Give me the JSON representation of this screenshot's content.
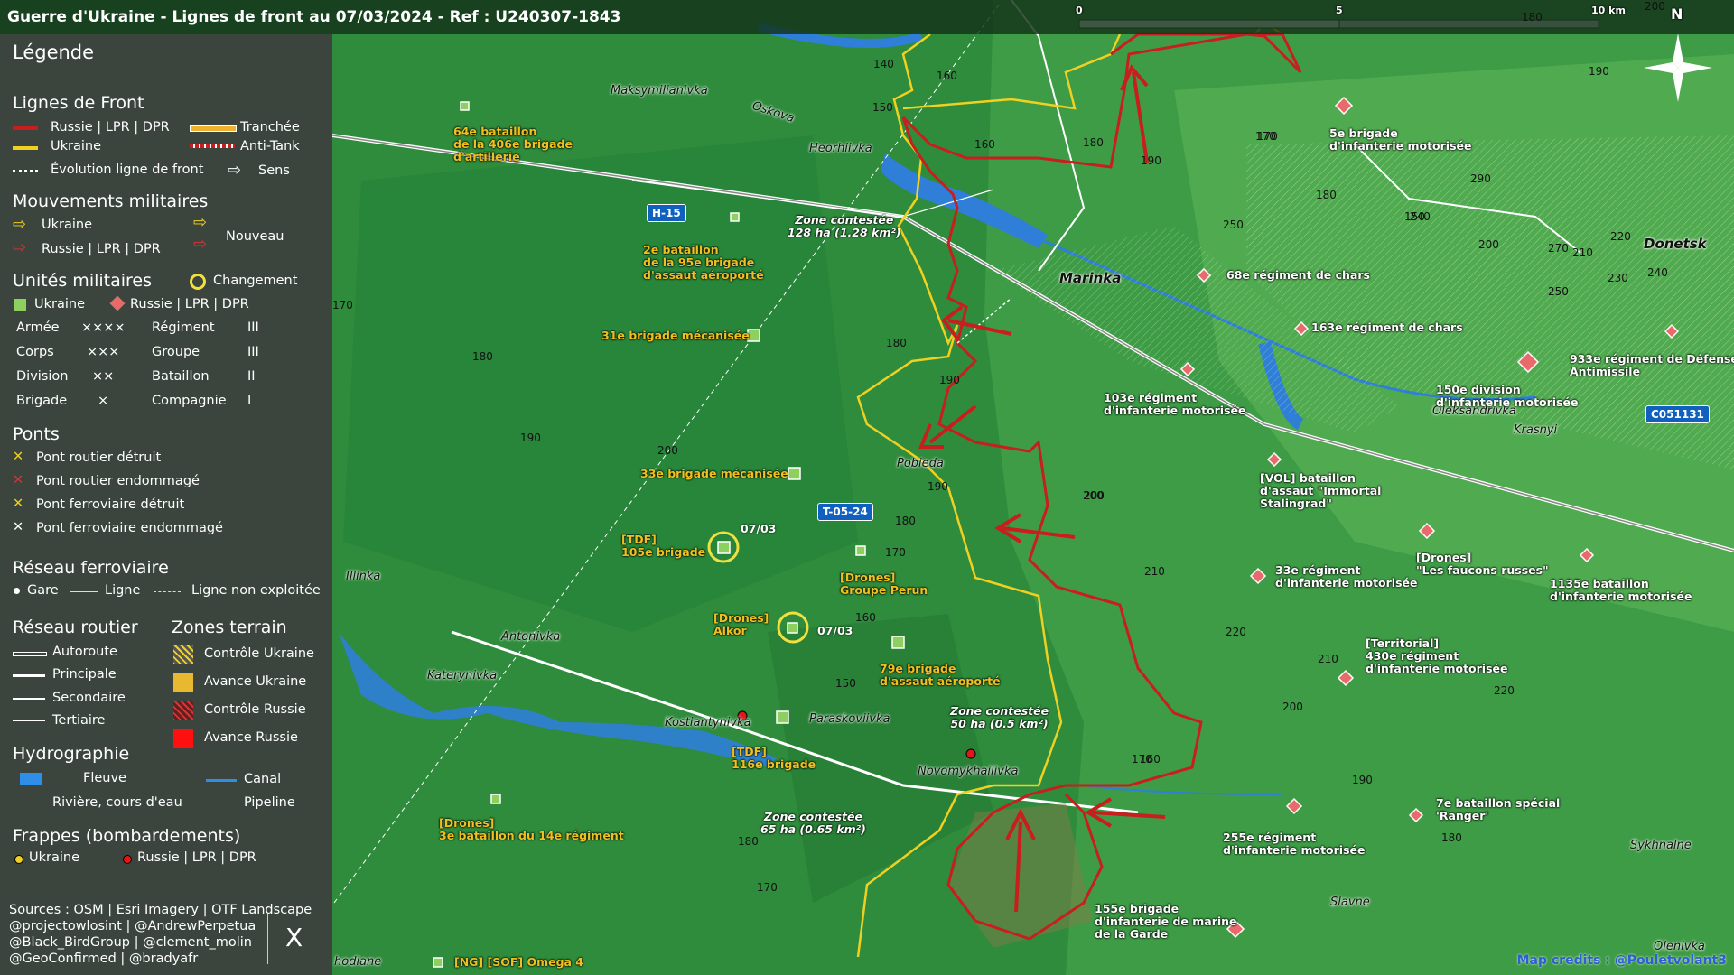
{
  "title": "Guerre d'Ukraine - Lignes de front au 07/03/2024 - Ref : U240307-1843",
  "scale": {
    "t0": "0",
    "t5": "5",
    "t10": "10 km"
  },
  "north": "N",
  "credits": "Map credits : @Pouletvolant3",
  "legend": {
    "title": "Légende",
    "front": {
      "title": "Lignes de Front",
      "russia": "Russie | LPR | DPR",
      "ukraine": "Ukraine",
      "trench": "Tranchée",
      "antitank": "Anti-Tank",
      "evolution": "Évolution ligne de front",
      "direction": "Sens"
    },
    "moves": {
      "title": "Mouvements militaires",
      "ukraine": "Ukraine",
      "russia": "Russie | LPR | DPR",
      "new": "Nouveau"
    },
    "units": {
      "title": "Unités militaires",
      "change": "Changement",
      "ukraine": "Ukraine",
      "russia": "Russie | LPR | DPR",
      "rows": [
        {
          "a": "Armée",
          "as": "××××",
          "b": "Régiment",
          "bs": "III"
        },
        {
          "a": "Corps",
          "as": "×××",
          "b": "Groupe",
          "bs": "III"
        },
        {
          "a": "Division",
          "as": "××",
          "b": "Bataillon",
          "bs": "II"
        },
        {
          "a": "Brigade",
          "as": "×",
          "b": "Compagnie",
          "bs": "I"
        }
      ]
    },
    "bridges": {
      "title": "Ponts",
      "items": [
        "Pont routier détruit",
        "Pont routier endommagé",
        "Pont ferroviaire détruit",
        "Pont ferroviaire endommagé"
      ]
    },
    "rail": {
      "title": "Réseau ferroviaire",
      "station": "Gare",
      "line": "Ligne",
      "unused": "Ligne non exploitée"
    },
    "roads": {
      "title": "Réseau routier",
      "items": [
        "Autoroute",
        "Principale",
        "Secondaire",
        "Tertiaire"
      ]
    },
    "zones": {
      "title": "Zones terrain",
      "items": [
        "Contrôle Ukraine",
        "Avance Ukraine",
        "Contrôle Russie",
        "Avance Russie"
      ]
    },
    "hydro": {
      "title": "Hydrographie",
      "river": "Fleuve",
      "canal": "Canal",
      "stream": "Rivière, cours d'eau",
      "pipeline": "Pipeline"
    },
    "strikes": {
      "title": "Frappes (bombardements)",
      "ukraine": "Ukraine",
      "russia": "Russie | LPR | DPR"
    },
    "sources": [
      "Sources : OSM | Esri Imagery | OTF Landscape",
      "@projectowlosint | @AndrewPerpetua",
      "@Black_BirdGroup | @clement_molin",
      "@GeoConfirmed | @bradyafr"
    ],
    "x_logo": "X"
  },
  "colors": {
    "russia": "#c81e1e",
    "ukraine": "#f0d020",
    "legend_bg": "#3c403e",
    "map_green": "#2a8a3a",
    "water": "#2f7fd8"
  },
  "roads": [
    "H-15",
    "T-05-24",
    "C051131"
  ],
  "towns": {
    "maksym": "Maksymilianivka",
    "oskova": "Oskova",
    "heorh": "Heorhiivka",
    "marinka": "Marinka",
    "pobieda": "Pobieda",
    "illinka": "Illinka",
    "antonivka": "Antonivka",
    "katerynivka": "Katerynivka",
    "kostiant": "Kostiantynivka",
    "paraskov": "Paraskoviivka",
    "novomykh": "Novomykhailivka",
    "oleksandr": "Oleksandrivka",
    "krasnyi": "Krasnyi",
    "donetsk": "Donetsk",
    "sykhnalne": "Sykhnalne",
    "slavne": "Slavne",
    "olenivka": "Olenivka",
    "hodiane": "hodiane"
  },
  "zones_contested": [
    {
      "line1": "Zone contestée",
      "line2": "128 ha (1.28 km²)"
    },
    {
      "line1": "Zone contestée",
      "line2": "50 ha (0.5 km²)"
    },
    {
      "line1": "Zone contestée",
      "line2": "65 ha (0.65 km²)"
    }
  ],
  "units_ua": {
    "u64": [
      "64e bataillon",
      "de la 406e brigade",
      "d'artillerie"
    ],
    "u2": [
      "2e bataillon",
      "de la 95e brigade",
      "d'assaut aéroporté"
    ],
    "u31": [
      "31e brigade mécanisée"
    ],
    "u33": [
      "33e brigade mécanisée"
    ],
    "tdf105": [
      "[TDF]",
      "105e brigade"
    ],
    "alkor": [
      "[Drones]",
      "Alkor"
    ],
    "perun": [
      "[Drones]",
      "Groupe Perun"
    ],
    "u79": [
      "79e brigade",
      "d'assaut aéroporté"
    ],
    "tdf116": [
      "[TDF]",
      "116e brigade"
    ],
    "drones14": [
      "[Drones]",
      "3e bataillon du 14e régiment"
    ],
    "omega": [
      "[NG] [SOF] Omega 4"
    ]
  },
  "units_ru": {
    "u5": [
      "5e brigade",
      "d'infanterie motorisée"
    ],
    "u68": [
      "68e régiment de chars"
    ],
    "u163": [
      "163e régiment de chars"
    ],
    "u933": [
      "933e régiment de Défense",
      "Antimissile"
    ],
    "u103": [
      "103e régiment",
      "d'infanterie motorisée"
    ],
    "u150": [
      "150e division",
      "d'infanterie motorisée"
    ],
    "vol": [
      "[VOL] bataillon",
      "d'assaut \"Immortal",
      "Stalingrad\""
    ],
    "u33r": [
      "33e régiment",
      "d'infanterie motorisée"
    ],
    "faucons": [
      "[Drones]",
      "\"Les faucons russes\""
    ],
    "u1135": [
      "1135e bataillon",
      "d'infanterie motorisée"
    ],
    "u430": [
      "[Territorial]",
      "430e régiment",
      "d'infanterie motorisée"
    ],
    "u255": [
      "255e régiment",
      "d'infanterie motorisée"
    ],
    "ranger": [
      "7e bataillon spécial",
      "'Ranger'"
    ],
    "u155": [
      "155e brigade",
      "d'infanterie de marine",
      "de la Garde"
    ]
  },
  "dates": {
    "d1": "07/03",
    "d2": "07/03"
  },
  "altitudes": [
    "140",
    "150",
    "160",
    "180",
    "190",
    "170",
    "200",
    "180",
    "190",
    "200",
    "180",
    "190",
    "150",
    "160",
    "170",
    "180",
    "170",
    "160",
    "190",
    "200",
    "210",
    "220",
    "200",
    "210",
    "220",
    "200",
    "190",
    "180",
    "170",
    "160",
    "250",
    "290",
    "240",
    "200",
    "270",
    "210",
    "220",
    "230",
    "240",
    "250",
    "190",
    "180",
    "180",
    "170",
    "150",
    "170",
    "180"
  ]
}
